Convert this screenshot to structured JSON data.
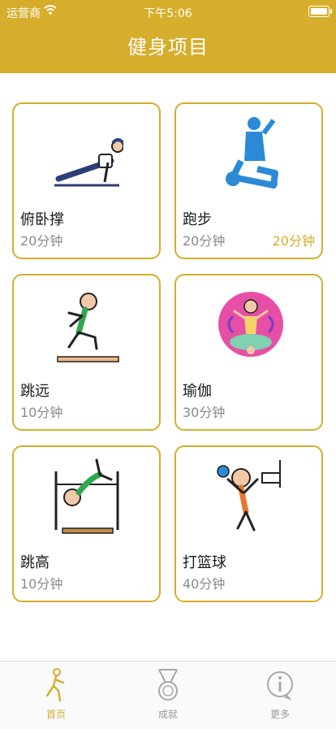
{
  "status": {
    "carrier": "运营商",
    "time": "下午5:06"
  },
  "header": {
    "title": "健身项目"
  },
  "cards": [
    {
      "name": "俯卧撑",
      "duration": "20分钟",
      "icon": "pushup-icon"
    },
    {
      "name": "跑步",
      "duration": "20分钟",
      "extra": "20分钟",
      "icon": "elliptical-machine-icon"
    },
    {
      "name": "跳远",
      "duration": "10分钟",
      "icon": "long-jump-icon"
    },
    {
      "name": "瑜伽",
      "duration": "30分钟",
      "icon": "yoga-icon"
    },
    {
      "name": "跳高",
      "duration": "10分钟",
      "icon": "high-jump-icon"
    },
    {
      "name": "打篮球",
      "duration": "40分钟",
      "icon": "basketball-icon"
    }
  ],
  "tabs": [
    {
      "label": "首页",
      "icon": "running-person-icon",
      "active": true
    },
    {
      "label": "成就",
      "icon": "medal-icon",
      "active": false
    },
    {
      "label": "更多",
      "icon": "info-icon",
      "active": false
    }
  ],
  "colors": {
    "accent": "#d6ae2c",
    "muted_text": "#8a8a8a"
  }
}
